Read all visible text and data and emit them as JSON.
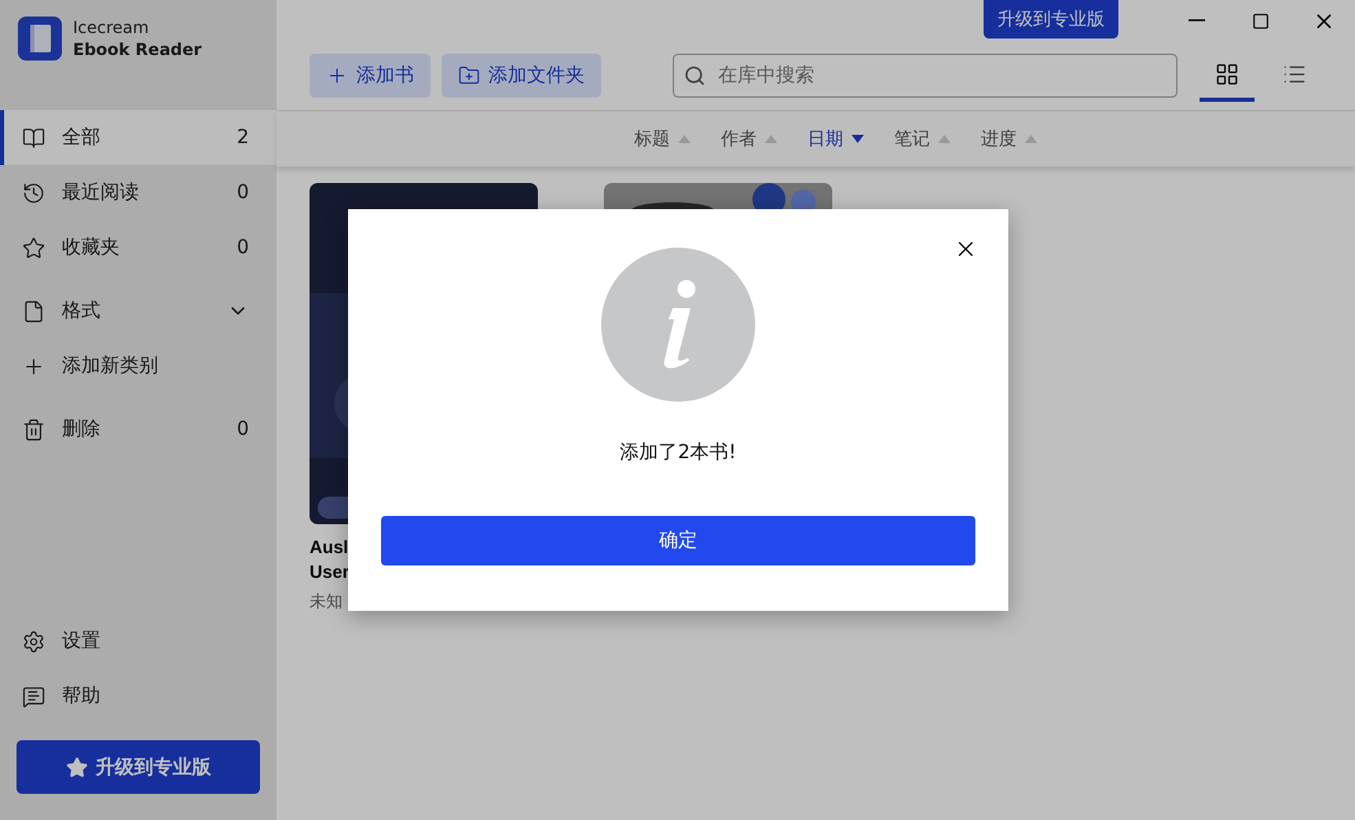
{
  "app": {
    "name": [
      "Icecream",
      "Ebook Reader"
    ]
  },
  "title_bar": {
    "upgrade_button": "升级到专业版"
  },
  "toolbar": {
    "buttons": [
      "添加书",
      "添加文件夹"
    ],
    "search": {
      "placeholder": "在库中搜索"
    },
    "views": [
      {
        "kind": "grid",
        "selected": true
      },
      {
        "kind": "list",
        "selected": false
      }
    ]
  },
  "sidebar": {
    "items": [
      {
        "kind": "nav",
        "label": "全部",
        "count": "2",
        "selected": true
      },
      {
        "kind": "nav",
        "label": "最近阅读",
        "count": "0",
        "selected": false
      },
      {
        "kind": "nav",
        "label": "收藏夹",
        "count": "0",
        "selected": false
      },
      {
        "kind": "group",
        "label": "格式",
        "expanded": false
      },
      {
        "kind": "action",
        "label": "添加新类别"
      },
      {
        "kind": "nav",
        "label": "删除",
        "count": "0",
        "selected": false
      }
    ],
    "bottom": [
      "设置",
      "帮助"
    ],
    "upgrade_button": "升级到专业版"
  },
  "sort_columns": [
    {
      "label": "标题",
      "selected": false
    },
    {
      "label": "作者",
      "selected": false
    },
    {
      "label": "日期",
      "selected": true
    },
    {
      "label": "笔记",
      "selected": false
    },
    {
      "label": "进度",
      "selected": false
    }
  ],
  "books": [
    {
      "cover": {
        "kind": "picture"
      },
      "title": [
        "Ausl",
        "User"
      ],
      "author": "未知"
    },
    {
      "cover": {
        "kind": "picture"
      }
    }
  ],
  "dialog": {
    "message": "添加了2本书!",
    "button": "确定"
  }
}
